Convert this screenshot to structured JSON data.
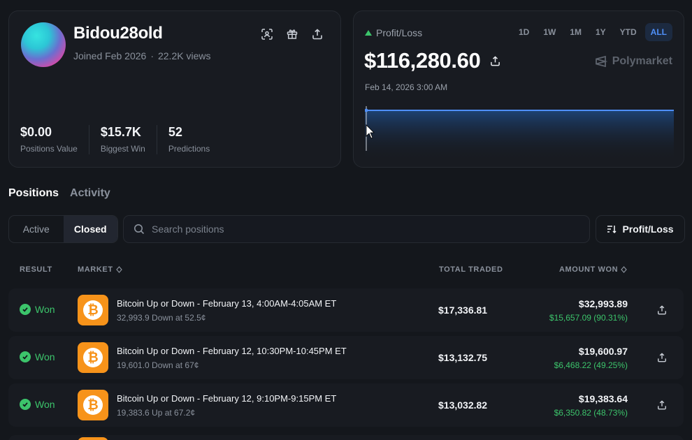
{
  "profile": {
    "username": "Bidou28old",
    "joined": "Joined Feb 2026",
    "views": "22.2K views",
    "stats": [
      {
        "value": "$0.00",
        "label": "Positions Value"
      },
      {
        "value": "$15.7K",
        "label": "Biggest Win"
      },
      {
        "value": "52",
        "label": "Predictions"
      }
    ],
    "icons": [
      "scan-icon",
      "gift-icon",
      "share-icon"
    ]
  },
  "pnl": {
    "label": "Profit/Loss",
    "value": "$116,280.60",
    "date": "Feb 14, 2026 3:00 AM",
    "brand": "Polymarket",
    "ranges": [
      "1D",
      "1W",
      "1M",
      "1Y",
      "YTD",
      "ALL"
    ],
    "active_range": "ALL",
    "accent": "#4f8ff7",
    "up_color": "#3cc46b"
  },
  "tabs": {
    "positions": "Positions",
    "activity": "Activity"
  },
  "filter": {
    "active": "Active",
    "closed": "Closed",
    "search_placeholder": "Search positions",
    "sort_label": "Profit/Loss"
  },
  "table": {
    "headers": {
      "result": "RESULT",
      "market": "MARKET",
      "total_traded": "TOTAL TRADED",
      "amount_won": "AMOUNT WON"
    },
    "rows": [
      {
        "result": "Won",
        "title": "Bitcoin Up or Down - February 13, 4:00AM-4:05AM ET",
        "subtitle": "32,993.9 Down at 52.5¢",
        "total_traded": "$17,336.81",
        "amount_won": "$32,993.89",
        "profit": "$15,657.09 (90.31%)"
      },
      {
        "result": "Won",
        "title": "Bitcoin Up or Down - February 12, 10:30PM-10:45PM ET",
        "subtitle": "19,601.0 Down at 67¢",
        "total_traded": "$13,132.75",
        "amount_won": "$19,600.97",
        "profit": "$6,468.22 (49.25%)"
      },
      {
        "result": "Won",
        "title": "Bitcoin Up or Down - February 12, 9:10PM-9:15PM ET",
        "subtitle": "19,383.6 Up at 67.2¢",
        "total_traded": "$13,032.82",
        "amount_won": "$19,383.64",
        "profit": "$6,350.82 (48.73%)"
      }
    ],
    "win_color": "#3cc46b",
    "btc_color": "#f7931a"
  }
}
